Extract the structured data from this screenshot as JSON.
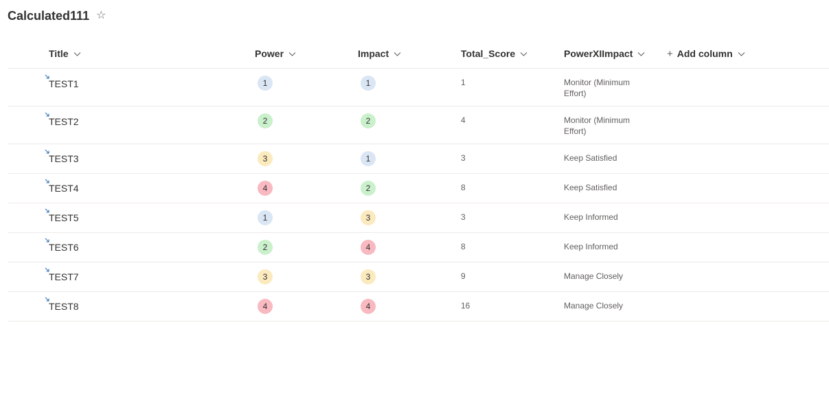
{
  "list": {
    "title": "Calculated111"
  },
  "columns": {
    "title": "Title",
    "power": "Power",
    "impact": "Impact",
    "total_score": "Total_Score",
    "power_x_impact": "PowerXIImpact",
    "add_column": "Add column"
  },
  "icons": {
    "favorite": "star-outline-icon",
    "sort": "chevron-down-icon",
    "add": "plus-icon",
    "new_item": "new-item-icon"
  },
  "badge_colors": {
    "1": "#dae6f4",
    "2": "#caf0cc",
    "3": "#fbeabd",
    "4": "#f8b9c0"
  },
  "rows": [
    {
      "title": "TEST1",
      "power": "1",
      "impact": "1",
      "total_score": "1",
      "power_x_impact": "Monitor (Minimum Effort)"
    },
    {
      "title": "TEST2",
      "power": "2",
      "impact": "2",
      "total_score": "4",
      "power_x_impact": "Monitor (Minimum Effort)"
    },
    {
      "title": "TEST3",
      "power": "3",
      "impact": "1",
      "total_score": "3",
      "power_x_impact": "Keep Satisfied"
    },
    {
      "title": "TEST4",
      "power": "4",
      "impact": "2",
      "total_score": "8",
      "power_x_impact": "Keep Satisfied"
    },
    {
      "title": "TEST5",
      "power": "1",
      "impact": "3",
      "total_score": "3",
      "power_x_impact": "Keep Informed"
    },
    {
      "title": "TEST6",
      "power": "2",
      "impact": "4",
      "total_score": "8",
      "power_x_impact": "Keep Informed"
    },
    {
      "title": "TEST7",
      "power": "3",
      "impact": "3",
      "total_score": "9",
      "power_x_impact": "Manage Closely"
    },
    {
      "title": "TEST8",
      "power": "4",
      "impact": "4",
      "total_score": "16",
      "power_x_impact": "Manage Closely"
    }
  ]
}
